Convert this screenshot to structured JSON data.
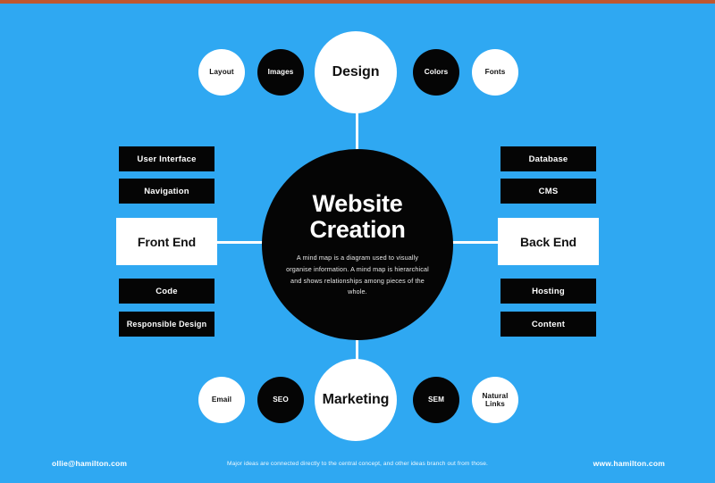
{
  "theme": {
    "background": "#2fa8f2",
    "ink": "#050505",
    "paper": "#ffffff",
    "top_strip": "#c0562f"
  },
  "center": {
    "title": "Website\nCreation",
    "description": "A mind map is a diagram used to visually organise information. A mind map is hierarchical and shows relationships among pieces of the whole."
  },
  "branches": {
    "design": {
      "label": "Design",
      "leaves": [
        {
          "label": "Layout",
          "style": "white"
        },
        {
          "label": "Images",
          "style": "black"
        },
        {
          "label": "Colors",
          "style": "black"
        },
        {
          "label": "Fonts",
          "style": "white"
        }
      ]
    },
    "marketing": {
      "label": "Marketing",
      "leaves": [
        {
          "label": "Email",
          "style": "white"
        },
        {
          "label": "SEO",
          "style": "black"
        },
        {
          "label": "SEM",
          "style": "black"
        },
        {
          "label": "Natural\nLinks",
          "style": "white"
        }
      ]
    },
    "front_end": {
      "label": "Front End",
      "leaves_above": [
        {
          "label": "User Interface"
        },
        {
          "label": "Navigation"
        }
      ],
      "leaves_below": [
        {
          "label": "Code"
        },
        {
          "label": "Responsible Design"
        }
      ]
    },
    "back_end": {
      "label": "Back End",
      "leaves_above": [
        {
          "label": "Database"
        },
        {
          "label": "CMS"
        }
      ],
      "leaves_below": [
        {
          "label": "Hosting"
        },
        {
          "label": "Content"
        }
      ]
    }
  },
  "footer": {
    "email": "ollie@hamilton.com",
    "caption": "Major ideas are connected directly to the central concept, and other ideas branch out from those.",
    "website": "www.hamilton.com"
  }
}
